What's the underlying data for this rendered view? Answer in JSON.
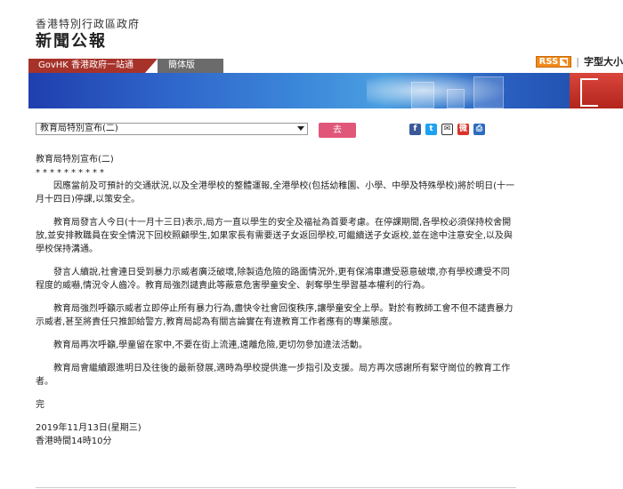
{
  "header": {
    "gov_name": "香港特別行政區政府",
    "site_title": "新聞公報",
    "rss_label": "RSS",
    "separator": "|",
    "font_size_label": "字型大小"
  },
  "nav": {
    "govhk_label": "GovHK 香港政府一站通",
    "simplified_label": "簡体版"
  },
  "toolbar": {
    "select_value": "教育局特別宣布(二)",
    "go_label": "去",
    "share_icons": [
      "facebook-icon",
      "twitter-icon",
      "email-icon",
      "weibo-icon",
      "print-icon"
    ]
  },
  "article": {
    "title": "教育局特別宣布(二)",
    "stars": "**********",
    "paragraphs": [
      "因應當前及可預計的交通狀況,以及全港學校的整體運報,全港學校(包括幼稚園、小學、中學及特殊學校)將於明日(十一月十四日)停課,以策安全。",
      "教育局發言人今日(十一月十三日)表示,局方一直以學生的安全及福祉為首要考慮。在停課期間,各學校必須保持校舍開放,並安排教職員在安全情況下回校照顧學生,如果家長有需要送子女返回學校,可繼續送子女返校,並在途中注意安全,以及與學校保持溝通。",
      "發言人續說,社會連日受到暴力示威者廣泛破壞,除製造危險的路面情況外,更有保鴻車遭受惡意破壞,亦有學校遭受不同程度的威嚇,情況令人齒冷。教育局強烈譴責此等蔽意危害學童安全、剝奪學生學習基本權利的行為。",
      "教育局強烈呼籲示威者立即停止所有暴力行為,盡快令社會回復秩序,讓學童安全上學。對於有教師工會不但不譴責暴力示威者,甚至將責任只推卸給警方,教育局認為有關言論實在有違教育工作者應有的專業態度。",
      "教育局再次呼籲,學童留在家中,不要在街上流連,遠離危險,更切勿參加違法活動。",
      "教育局會繼續跟進明日及往後的最新發展,適時為學校提供進一步指引及支援。局方再次感謝所有緊守崗位的教育工作者。"
    ],
    "end_mark": "完",
    "date": "2019年11月13日(星期三)",
    "time": "香港時間14時10分"
  }
}
